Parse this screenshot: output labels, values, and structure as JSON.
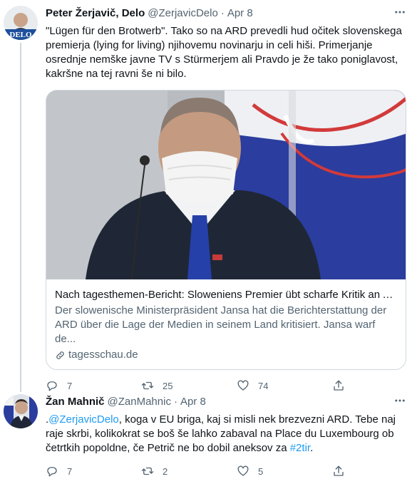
{
  "tweets": [
    {
      "author": "Peter Žerjavič, Delo",
      "handle": "@ZerjavicDelo",
      "separator": "·",
      "time": "Apr 8",
      "avatar_label": "DELO",
      "text": "\"Lügen für den Brotwerb\". Tako so na ARD prevedli hud očitek slovenskega premierja (lying for living) njihovemu novinarju in celi hiši. Primerjanje osrednje nemške javne TV s Stürmerjem ali Pravdo je že tako poniglavost, kakršne na tej ravni še ni bilo.",
      "card": {
        "title": "Nach tagesthemen-Bericht: Sloweniens Premier übt scharfe Kritik an A...",
        "description": "Der slowenische Ministerpräsident Jansa hat die Berichterstattung der ARD über die Lage der Medien in seinem Land kritisiert. Jansa warf de...",
        "domain": "tagesschau.de"
      },
      "replies": "7",
      "retweets": "25",
      "likes": "74"
    },
    {
      "author": "Žan Mahnič",
      "handle": "@ZanMahnic",
      "separator": "·",
      "time": "Apr 8",
      "text_prefix": ".",
      "mention": "@ZerjavicDelo",
      "text_middle": ", koga v EU briga, kaj si misli nek brezvezni ARD. Tebe naj raje skrbi, kolikokrat se boš še lahko zabaval na Place du Luxembourg ob četrtkih popoldne, če Petrič ne bo dobil aneksov za ",
      "hashtag": "#2tir",
      "text_suffix": ".",
      "replies": "7",
      "retweets": "2",
      "likes": "5"
    }
  ],
  "icons": {
    "more": "more-horizontal-icon",
    "reply": "reply-icon",
    "retweet": "retweet-icon",
    "like": "heart-icon",
    "share": "share-icon",
    "link": "link-icon"
  },
  "colors": {
    "text": "#0f1419",
    "secondary": "#536471",
    "accent": "#1d9bf0",
    "border": "#cfd9de"
  }
}
